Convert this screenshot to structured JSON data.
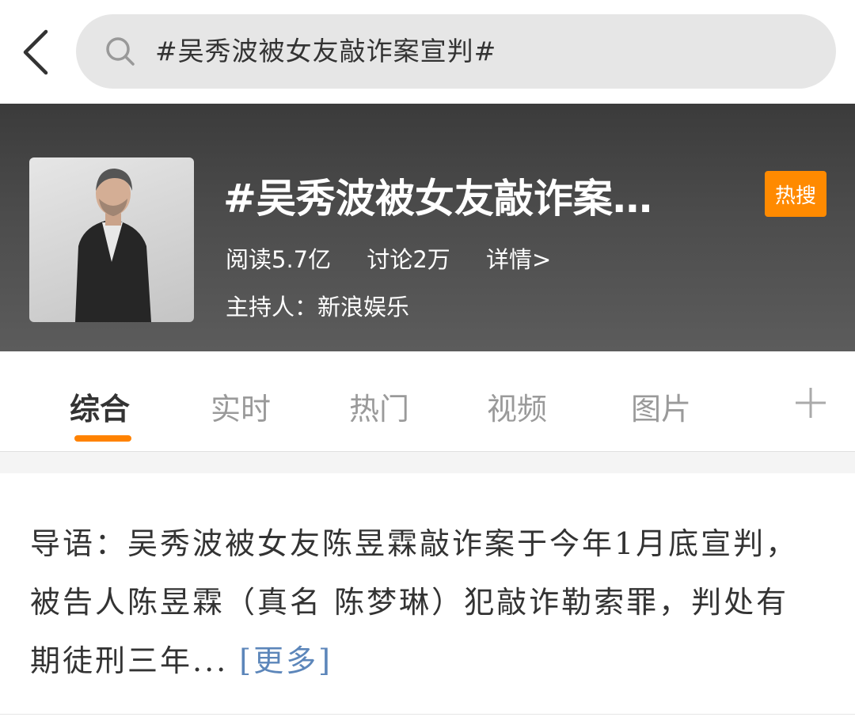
{
  "search": {
    "query": "#吴秀波被女友敲诈案宣判#"
  },
  "topic": {
    "title": "#吴秀波被女友敲诈案…",
    "badge": "热搜",
    "reads": "阅读5.7亿",
    "discussions": "讨论2万",
    "details": "详情>",
    "host": "主持人：新浪娱乐"
  },
  "tabs": {
    "items": [
      {
        "label": "综合",
        "active": true
      },
      {
        "label": "实时",
        "active": false
      },
      {
        "label": "热门",
        "active": false
      },
      {
        "label": "视频",
        "active": false
      },
      {
        "label": "图片",
        "active": false
      }
    ],
    "accent": "#ff8200"
  },
  "intro": {
    "text": "导语：吴秀波被女友陈昱霖敲诈案于今年1月底宣判，被告人陈昱霖（真名 陈梦琳）犯敲诈勒索罪，判处有期徒刑三年...",
    "more": "[更多]"
  },
  "icons": {
    "back": "back-arrow-icon",
    "search": "search-icon",
    "add": "plus-icon"
  },
  "colors": {
    "header_bg": "#4a4a4a",
    "badge_bg": "#ff8a00",
    "link": "#5c86ba"
  }
}
